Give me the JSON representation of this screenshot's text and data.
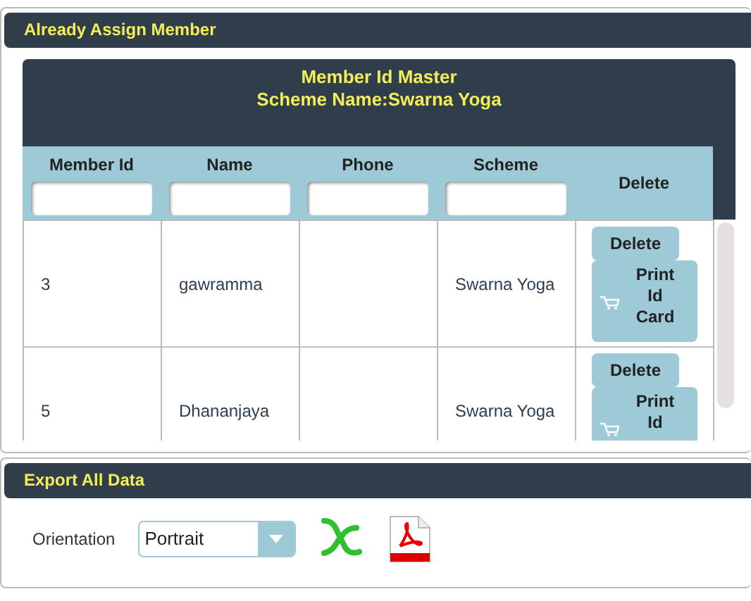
{
  "assign_panel": {
    "title": "Already Assign Member",
    "grid": {
      "title_lines": [
        "Member Id Master",
        "Scheme Name:Swarna Yoga"
      ],
      "columns": [
        {
          "label": "Member Id",
          "kind": "filter"
        },
        {
          "label": "Name",
          "kind": "filter"
        },
        {
          "label": "Phone",
          "kind": "filter"
        },
        {
          "label": "Scheme",
          "kind": "filter"
        },
        {
          "label": "Delete",
          "kind": "plain"
        }
      ],
      "rows": [
        {
          "cells": [
            "3",
            "gawramma",
            null,
            "Swarna Yoga"
          ],
          "delete_button": "Delete",
          "print_button": "Print Id Card"
        },
        {
          "cells": [
            "5",
            "Dhananjaya",
            null,
            "Swarna Yoga"
          ],
          "delete_button": "Delete",
          "print_button": "Print Id"
        }
      ]
    }
  },
  "export_panel": {
    "title": "Export All Data",
    "orientation_label": "Orientation",
    "orientation_value": "Portrait"
  }
}
